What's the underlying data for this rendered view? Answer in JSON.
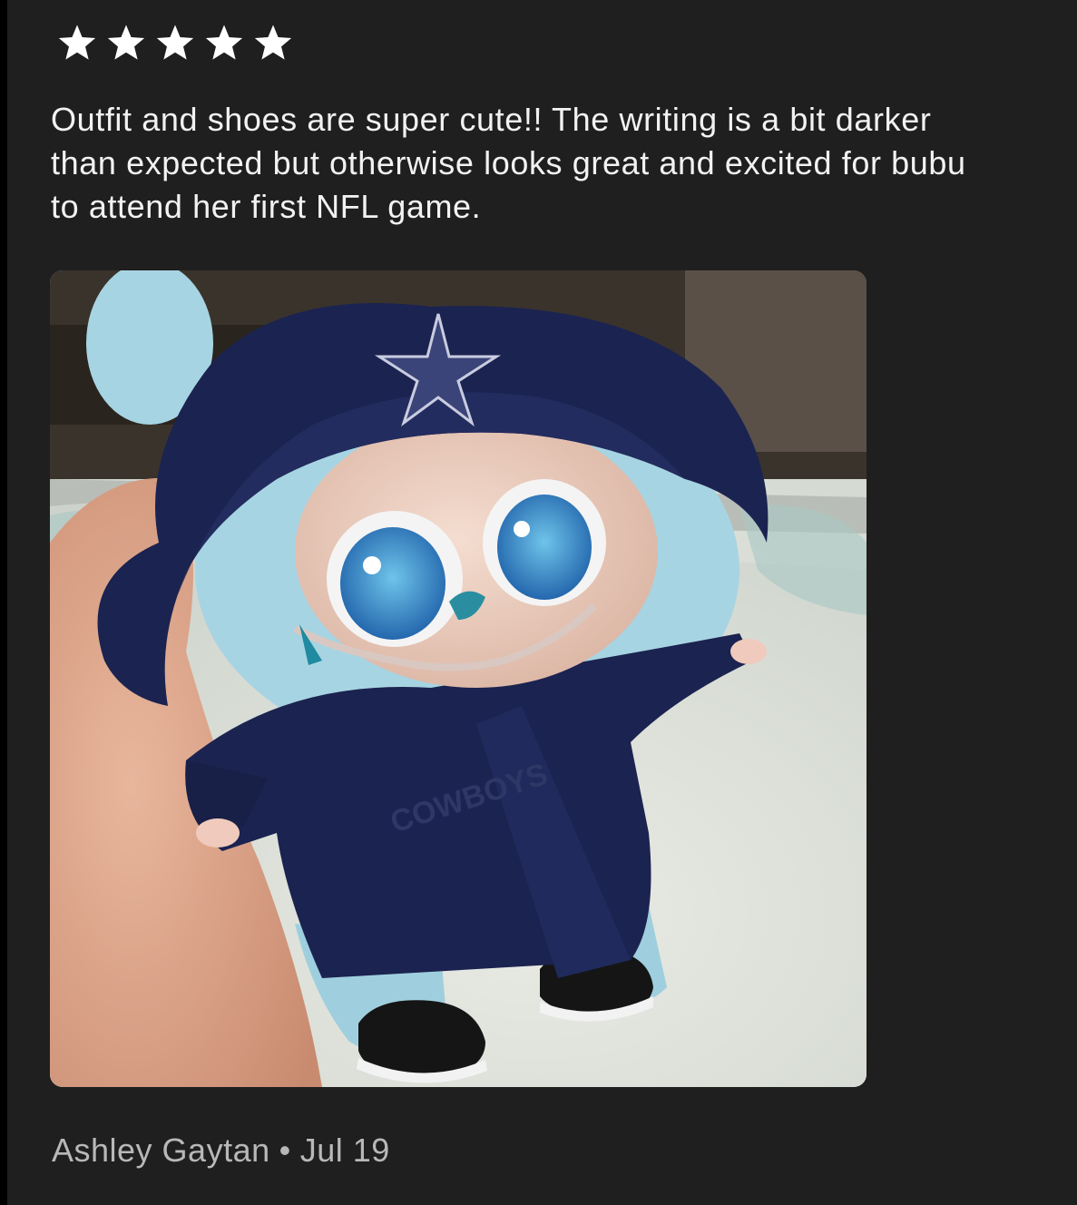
{
  "review": {
    "rating": 5,
    "rating_max": 5,
    "star_color": "#ffffff",
    "text": "Outfit and shoes are super cute!! The writing is a bit darker than expected but otherwise looks great and excited for bubu to attend her first NFL game.",
    "photo": {
      "subject": "blue plush doll in navy bucket hat with star and navy jacket, held in a hand"
    },
    "author": "Ashley Gaytan",
    "separator": "•",
    "date": "Jul 19"
  },
  "colors": {
    "card_background": "#1f1f1f",
    "text_primary": "#f2f2f2",
    "text_secondary": "#b8b8b8",
    "navy": "#1b2350",
    "plush_blue": "#a9d3e0"
  }
}
